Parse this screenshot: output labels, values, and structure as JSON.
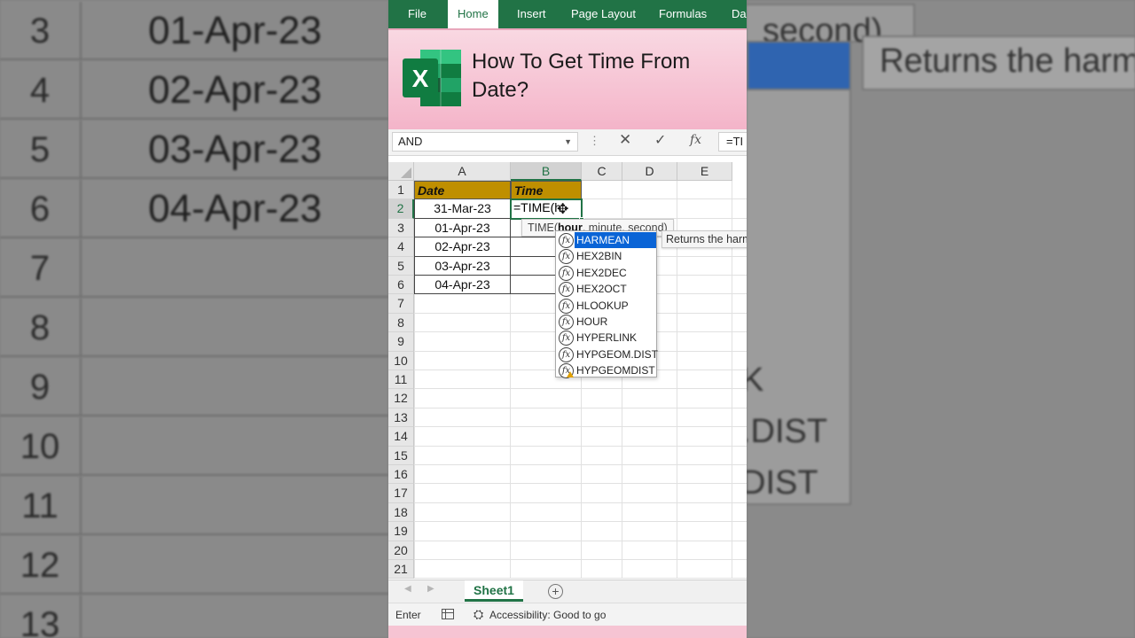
{
  "ribbon": {
    "tabs": [
      "File",
      "Home",
      "Insert",
      "Page Layout",
      "Formulas",
      "Da"
    ],
    "active": "Home"
  },
  "banner": {
    "title": "How To Get Time From Date?"
  },
  "formula_bar": {
    "name_box": "AND",
    "fx": "fx",
    "content": "=TI"
  },
  "columns": [
    "A",
    "B",
    "C",
    "D",
    "E"
  ],
  "rows": [
    "1",
    "2",
    "3",
    "4",
    "5",
    "6",
    "7",
    "8",
    "9",
    "10",
    "11",
    "12",
    "13",
    "14",
    "15",
    "16",
    "17",
    "18",
    "19",
    "20",
    "21"
  ],
  "table": {
    "header_a": "Date",
    "header_b": "Time",
    "dates": [
      "31-Mar-23",
      "01-Apr-23",
      "02-Apr-23",
      "03-Apr-23",
      "04-Apr-23"
    ],
    "editing_formula": "=TIME(h"
  },
  "tooltip": {
    "func": "TIME(",
    "arg_bold": "hour",
    "rest": ", minute, second)"
  },
  "autocomplete": {
    "items": [
      "HARMEAN",
      "HEX2BIN",
      "HEX2DEC",
      "HEX2OCT",
      "HLOOKUP",
      "HOUR",
      "HYPERLINK",
      "HYPGEOM.DIST",
      "HYPGEOMDIST"
    ],
    "selected": "HARMEAN",
    "description": "Returns the harm"
  },
  "sheet_tabs": {
    "active": "Sheet1",
    "add": "+"
  },
  "status_bar": {
    "mode": "Enter",
    "accessibility": "Accessibility: Good to go"
  },
  "backdrop_left": {
    "rows": [
      {
        "num": "3",
        "val": "01-Apr-23"
      },
      {
        "num": "4",
        "val": "02-Apr-23"
      },
      {
        "num": "5",
        "val": "03-Apr-23"
      },
      {
        "num": "6",
        "val": "04-Apr-23"
      },
      {
        "num": "7",
        "val": ""
      },
      {
        "num": "8",
        "val": ""
      },
      {
        "num": "9",
        "val": ""
      },
      {
        "num": "10",
        "val": ""
      },
      {
        "num": "11",
        "val": ""
      },
      {
        "num": "12",
        "val": ""
      },
      {
        "num": "13",
        "val": ""
      }
    ]
  },
  "backdrop_right": {
    "top": "second)",
    "desc": "Returns the harm",
    "k": "K",
    "dist1": ".DIST",
    "dist2": "DIST"
  },
  "colors": {
    "excel_green": "#217346",
    "header_fill": "#bf8f00",
    "banner_pink": "#f4b3c8",
    "selection_blue": "#0a64d6"
  }
}
